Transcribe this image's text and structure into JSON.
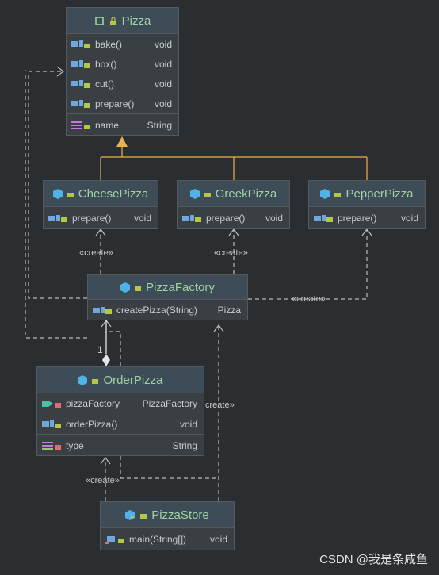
{
  "classes": {
    "pizza": {
      "name": "Pizza",
      "methods": [
        {
          "name": "bake()",
          "type": "void"
        },
        {
          "name": "box()",
          "type": "void"
        },
        {
          "name": "cut()",
          "type": "void"
        },
        {
          "name": "prepare()",
          "type": "void"
        }
      ],
      "fields": [
        {
          "name": "name",
          "type": "String"
        }
      ]
    },
    "cheese": {
      "name": "CheesePizza",
      "methods": [
        {
          "name": "prepare()",
          "type": "void"
        }
      ]
    },
    "greek": {
      "name": "GreekPizza",
      "methods": [
        {
          "name": "prepare()",
          "type": "void"
        }
      ]
    },
    "pepper": {
      "name": "PepperPizza",
      "methods": [
        {
          "name": "prepare()",
          "type": "void"
        }
      ]
    },
    "factory": {
      "name": "PizzaFactory",
      "methods": [
        {
          "name": "createPizza(String)",
          "type": "Pizza"
        }
      ]
    },
    "order": {
      "name": "OrderPizza",
      "fields_top": [
        {
          "name": "pizzaFactory",
          "type": "PizzaFactory"
        }
      ],
      "methods": [
        {
          "name": "orderPizza()",
          "type": "void"
        }
      ],
      "fields": [
        {
          "name": "type",
          "type": "String"
        }
      ]
    },
    "store": {
      "name": "PizzaStore",
      "methods": [
        {
          "name": "main(String[])",
          "type": "void"
        }
      ]
    }
  },
  "labels": {
    "create1": "«create»",
    "create2": "«create»",
    "create3": "«create»",
    "create4": "create»",
    "create5": "«create»",
    "multiplicity": "1"
  },
  "watermark": "CSDN @我是条咸鱼",
  "colors": {
    "background": "#2b2e31",
    "header": "#3d4c56",
    "class_name": "#9fd3a3",
    "inheritance": "#e7b34c",
    "dashed": "#b9bcbf"
  }
}
